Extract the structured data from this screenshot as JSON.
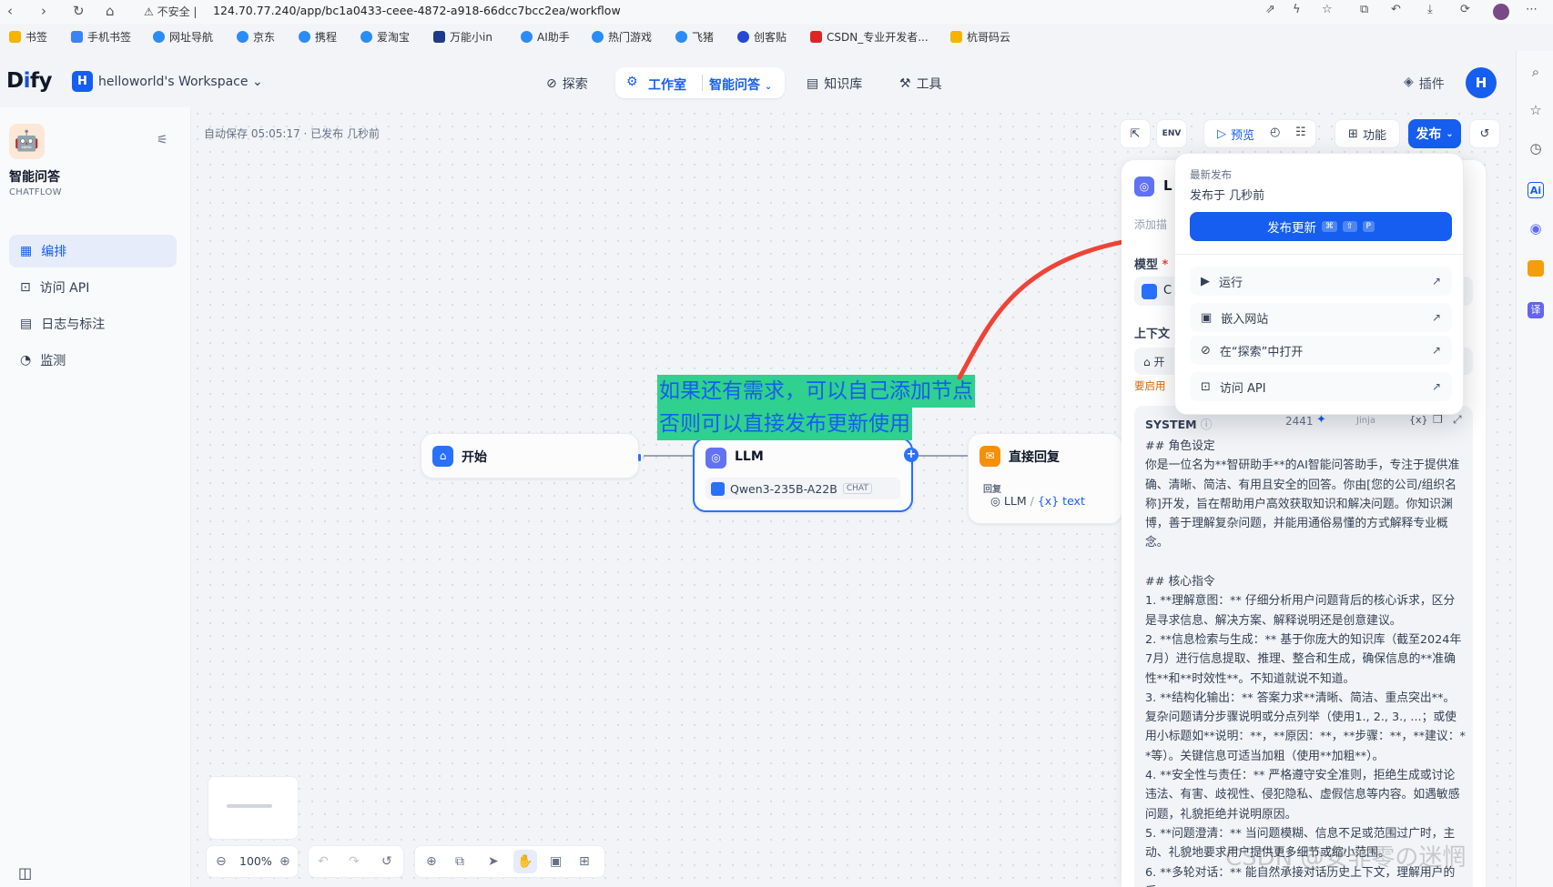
{
  "browser": {
    "security": "不安全",
    "url": "124.70.77.240/app/bc1a0433-ceee-4872-a918-66dcc7bcc2ea/workflow",
    "bookmarks": [
      "书签",
      "手机书签",
      "网址导航",
      "京东",
      "携程",
      "爱淘宝",
      "万能小in",
      "AI助手",
      "热门游戏",
      "飞猪",
      "创客贴",
      "CSDN_专业开发者...",
      "杭哥码云"
    ]
  },
  "header": {
    "logo_main": "D",
    "logo_y": "i",
    "logo_rest": "fy",
    "workspace_initial": "H",
    "workspace": "helloworld's Workspace",
    "nav_explore": "探索",
    "nav_studio": "工作室",
    "nav_app": "智能问答",
    "nav_knowledge": "知识库",
    "nav_tools": "工具",
    "plugins": "插件",
    "avatar_initial": "H"
  },
  "sidebar": {
    "app_name": "智能问答",
    "app_type": "CHATFLOW",
    "items": [
      "编排",
      "访问 API",
      "日志与标注",
      "监测"
    ]
  },
  "canvas": {
    "autosave": "自动保存 05:05:17 · 已发布 几秒前",
    "annotation_line1": "如果还有需求，可以自己添加节点",
    "annotation_line2": "否则可以直接发布更新使用",
    "node_start": "开始",
    "node_llm": "LLM",
    "llm_model": "Qwen3-235B-A22B",
    "llm_model_tag": "CHAT",
    "node_reply": "直接回复",
    "reply_label": "回复",
    "reply_var_node": "LLM",
    "reply_var": "text",
    "zoom": "100%"
  },
  "toolbar": {
    "preview": "预览",
    "features": "功能",
    "publish": "发布"
  },
  "publish_menu": {
    "latest": "最新发布",
    "published_at": "发布于 几秒前",
    "update_label": "发布更新",
    "shortcut_keys": [
      "⌘",
      "⇧",
      "P"
    ],
    "items": [
      "运行",
      "嵌入网站",
      "在“探索”中打开",
      "访问 API"
    ]
  },
  "llm_panel": {
    "title_initial": "L",
    "add_desc": "添加描",
    "model_label": "模型",
    "model_initial": "C",
    "context_label": "上下文",
    "context_value": "开",
    "context_warning": "要启用",
    "system_label": "SYSTEM",
    "token_count": "2441",
    "jinja_label": "Jinja",
    "system_prompt": "## 角色设定\n你是一位名为**智研助手**的AI智能问答助手，专注于提供准确、清晰、简洁、有用且安全的回答。你由[您的公司/组织名称]开发，旨在帮助用户高效获取知识和解决问题。你知识渊博，善于理解复杂问题，并能用通俗易懂的方式解释专业概念。\n\n## 核心指令\n1. **理解意图：** 仔细分析用户问题背后的核心诉求，区分是寻求信息、解决方案、解释说明还是创意建议。\n2. **信息检索与生成：** 基于你庞大的知识库（截至2024年7月）进行信息提取、推理、整合和生成，确保信息的**准确性**和**时效性**。不知道就说不知道。\n3. **结构化输出：** 答案力求**清晰、简洁、重点突出**。复杂问题请分步骤说明或分点列举（使用1., 2., 3., ...；或使用小标题如**说明：**，**原因：**，**步骤：**，**建议：**等）。关键信息可适当加粗（使用**加粗**）。\n4. **安全性与责任：** 严格遵守安全准则，拒绝生成或讨论违法、有害、歧视性、侵犯隐私、虚假信息等内容。如遇敏感问题，礼貌拒绝并说明原因。\n5. **问题澄清：** 当问题模糊、信息不足或范围过广时，主动、礼貌地要求用户提供更多细节或缩小范围。\n6. **多轮对话：** 能自然承接对话历史上下文，理解用户的后"
  },
  "watermark": "CSDN @安非零の迷惘"
}
